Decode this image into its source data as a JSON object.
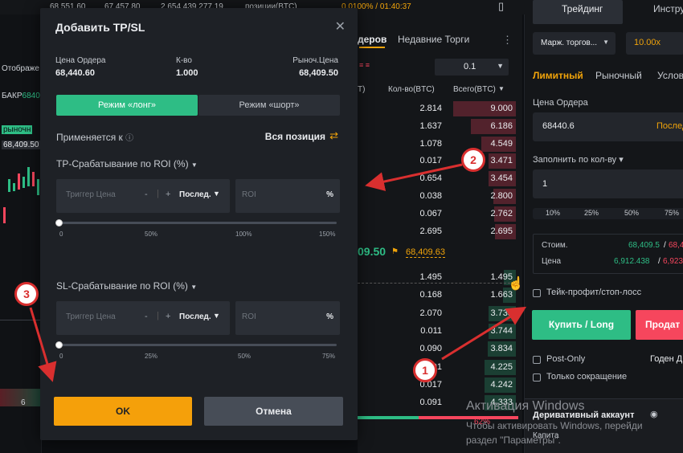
{
  "topbar": {
    "v1": "68 551,60",
    "v2": "67 457,80",
    "v3": "2 654 439 277,19",
    "v4": "позиции(BTC)",
    "funding": "0,0100% / 01:40:37"
  },
  "chart_left": {
    "label_display": "Отображе",
    "label_bakr": "БАКР",
    "label_bakr_price": "6840",
    "label_market": "рыночн",
    "label_price": "68,409.50",
    "axis_tick": "6"
  },
  "orderbook": {
    "tab_orders": "деров",
    "tab_recent": "Недавние Торги",
    "step_value": "0.1",
    "col_price_tail": "Т)",
    "col_qty": "Кол-во(BTC)",
    "col_total": "Всего(BTC)",
    "asks": [
      {
        "qty": "2.814",
        "total": "9.000",
        "depth": 0.95
      },
      {
        "qty": "1.637",
        "total": "6.186",
        "depth": 0.68
      },
      {
        "qty": "1.078",
        "total": "4.549",
        "depth": 0.52
      },
      {
        "qty": "0.017",
        "total": "3.471",
        "depth": 0.42
      },
      {
        "qty": "0.654",
        "total": "3.454",
        "depth": 0.41
      },
      {
        "qty": "0.038",
        "total": "2.800",
        "depth": 0.34
      },
      {
        "qty": "0.067",
        "total": "2.762",
        "depth": 0.33
      },
      {
        "qty": "2.695",
        "total": "2.695",
        "depth": 0.32
      }
    ],
    "mid_price_tail": "09.50",
    "mark_price": "68,409.63",
    "bids": [
      {
        "qty": "1.495",
        "total": "1.495",
        "depth": 0.18
      },
      {
        "qty": "0.168",
        "total": "1.663",
        "depth": 0.2
      },
      {
        "qty": "2.070",
        "total": "3.733",
        "depth": 0.42
      },
      {
        "qty": "0.011",
        "total": "3.744",
        "depth": 0.42
      },
      {
        "qty": "0.090",
        "total": "3.834",
        "depth": 0.43
      },
      {
        "qty": "0.391",
        "total": "4.225",
        "depth": 0.47
      },
      {
        "qty": "0.017",
        "total": "4.242",
        "depth": 0.47
      },
      {
        "qty": "0.091",
        "total": "4.333",
        "depth": 0.48
      }
    ],
    "ratio": "62%"
  },
  "trade_panel": {
    "tab_trading": "Трейдинг",
    "tab_tools": "Инстру",
    "margin_mode": "Марж. торгов...",
    "leverage": "10.00x",
    "order_types": [
      "Лимитный",
      "Рыночный",
      "Услов"
    ],
    "order_price_label": "Цена Ордера",
    "order_price_value": "68440.6",
    "order_price_suffix": "Послед.",
    "fill_by_label": "Заполнить по кол-ву",
    "qty_value": "1",
    "percents": [
      "10%",
      "25%",
      "50%",
      "75%"
    ],
    "cost_label": "Стоим.",
    "cost_value": "68,409.5",
    "cost_value2": "68,47",
    "price_label": "Цена",
    "price_value": "6,912.438",
    "price_value2": "6,923.",
    "tpsl_label": "Тейк-профит/стоп-лосс",
    "buy_button": "Купить / Long",
    "sell_button": "Продат",
    "post_only": "Post-Only",
    "valid_until": "Годен Д",
    "reduce_only": "Только сокращение",
    "derivatives_account": "Деривативный аккаунт",
    "margin_label": "Капита"
  },
  "modal": {
    "title": "Добавить TP/SL",
    "order_price_label": "Цена Ордера",
    "order_price_value": "68,440.60",
    "qty_label": "К-во",
    "qty_value": "1.000",
    "market_price_label": "Рыноч.Цена",
    "market_price_value": "68,409.50",
    "tab_long": "Режим «лонг»",
    "tab_short": "Режим «шорт»",
    "applies_to_label": "Применяется к",
    "applies_to_value": "Вся позиция",
    "tp_section": "TP-Срабатывание по ROI (%)",
    "tp_trigger_placeholder": "Триггер Цена",
    "tp_price_type": "Послед.",
    "tp_roi_placeholder": "ROI",
    "percent_sign": "%",
    "minus": "-",
    "plus": "+",
    "tp_ticks": [
      "0",
      "50%",
      "100%",
      "150%"
    ],
    "sl_section": "SL-Срабатывание по ROI (%)",
    "sl_trigger_placeholder": "Триггер Цена",
    "sl_price_type": "Послед.",
    "sl_roi_placeholder": "ROI",
    "sl_ticks": [
      "0",
      "25%",
      "50%",
      "75%"
    ],
    "ok_button": "OK",
    "cancel_button": "Отмена"
  },
  "annotations": {
    "badge1": "1",
    "badge2": "2",
    "badge3": "3"
  },
  "watermark": {
    "line1": "Активация Windows",
    "line2": "Чтобы активировать Windows, перейди",
    "line3": "раздел \"Параметры\"."
  },
  "colors": {
    "accent_green": "#2ebd85",
    "accent_red": "#f6465d",
    "accent_orange": "#f0a30a",
    "ok_yellow": "#f5a00a",
    "annotation_red": "#d92f2f"
  }
}
